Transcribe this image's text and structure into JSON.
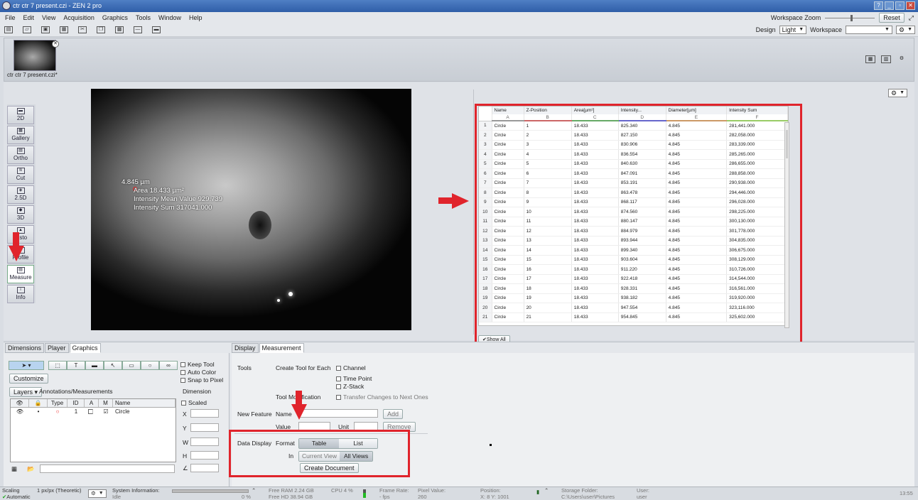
{
  "window": {
    "title": "ctr ctr 7 present.czi - ZEN 2 pro",
    "reset": "Reset"
  },
  "menu": [
    "File",
    "Edit",
    "View",
    "Acquisition",
    "Graphics",
    "Tools",
    "Window",
    "Help"
  ],
  "workspace_zoom": "Workspace Zoom",
  "design": {
    "label": "Design",
    "value": "Light",
    "workspace_label": "Workspace",
    "workspace_value": ""
  },
  "document": {
    "name": "ctr ctr 7 present.czi*"
  },
  "view_buttons": [
    "2D",
    "Gallery",
    "Ortho",
    "Cut",
    "2.5D",
    "3D",
    "Histo",
    "Profile",
    "Measure",
    "Info"
  ],
  "overlay": {
    "diameter": "4.845 µm",
    "area": "Area 18.433 µm²",
    "mean": "Intensity Mean Value 929.739",
    "sum": "Intensity Sum 317041.000"
  },
  "table": {
    "headers": [
      "Name",
      "Z-Position",
      "Area[µm²]",
      "Intensity...",
      "Diameter[µm]",
      "Intensity Sum"
    ],
    "letters": [
      "A",
      "B",
      "C",
      "D",
      "E",
      "F"
    ],
    "rows": [
      [
        "1",
        "Circle",
        "1",
        "18.433",
        "825.340",
        "4.845",
        "281,441.000"
      ],
      [
        "2",
        "Circle",
        "2",
        "18.433",
        "827.150",
        "4.845",
        "282,058.000"
      ],
      [
        "3",
        "Circle",
        "3",
        "18.433",
        "830.906",
        "4.845",
        "283,339.000"
      ],
      [
        "4",
        "Circle",
        "4",
        "18.433",
        "836.554",
        "4.845",
        "285,265.000"
      ],
      [
        "5",
        "Circle",
        "5",
        "18.433",
        "840.630",
        "4.845",
        "286,655.000"
      ],
      [
        "6",
        "Circle",
        "6",
        "18.433",
        "847.091",
        "4.845",
        "288,858.000"
      ],
      [
        "7",
        "Circle",
        "7",
        "18.433",
        "853.191",
        "4.845",
        "290,938.000"
      ],
      [
        "8",
        "Circle",
        "8",
        "18.433",
        "863.478",
        "4.845",
        "294,446.000"
      ],
      [
        "9",
        "Circle",
        "9",
        "18.433",
        "868.117",
        "4.845",
        "296,028.000"
      ],
      [
        "10",
        "Circle",
        "10",
        "18.433",
        "874.560",
        "4.845",
        "298,225.000"
      ],
      [
        "11",
        "Circle",
        "11",
        "18.433",
        "880.147",
        "4.845",
        "300,130.000"
      ],
      [
        "12",
        "Circle",
        "12",
        "18.433",
        "884.979",
        "4.845",
        "301,778.000"
      ],
      [
        "13",
        "Circle",
        "13",
        "18.433",
        "893.944",
        "4.845",
        "304,835.000"
      ],
      [
        "14",
        "Circle",
        "14",
        "18.433",
        "899.340",
        "4.845",
        "306,675.000"
      ],
      [
        "15",
        "Circle",
        "15",
        "18.433",
        "903.604",
        "4.845",
        "308,129.000"
      ],
      [
        "16",
        "Circle",
        "16",
        "18.433",
        "911.220",
        "4.845",
        "310,726.000"
      ],
      [
        "17",
        "Circle",
        "17",
        "18.433",
        "922.418",
        "4.845",
        "314,544.000"
      ],
      [
        "18",
        "Circle",
        "18",
        "18.433",
        "928.331",
        "4.845",
        "316,561.000"
      ],
      [
        "19",
        "Circle",
        "19",
        "18.433",
        "938.182",
        "4.845",
        "319,920.000"
      ],
      [
        "20",
        "Circle",
        "20",
        "18.433",
        "947.554",
        "4.845",
        "323,116.000"
      ],
      [
        "21",
        "Circle",
        "21",
        "18.433",
        "954.845",
        "4.845",
        "325,602.000"
      ]
    ],
    "show_all": "Show All"
  },
  "left_tabs": [
    "Dimensions",
    "Player",
    "Graphics"
  ],
  "graphics": {
    "customize": "Customize",
    "keep_tool": "Keep Tool",
    "auto_color": "Auto Color",
    "snap": "Snap to Pixel",
    "layers": "Layers",
    "annotations": "Annotations/Measurements",
    "dimension": "Dimension",
    "scaled": "Scaled",
    "cols": [
      "Type",
      "ID",
      "A",
      "M",
      "Name"
    ],
    "row": {
      "id": "1",
      "name": "Circle"
    },
    "fields": [
      "X",
      "Y",
      "W",
      "H"
    ]
  },
  "right_tabs": [
    "Display",
    "Measurement"
  ],
  "measurement": {
    "tools": "Tools",
    "create_tool": "Create Tool for Each",
    "channel": "Channel",
    "time_point": "Time Point",
    "z_stack": "Z-Stack",
    "tool_mod": "Tool Modification",
    "transfer": "Transfer Changes to Next Ones",
    "new_feature": "New Feature",
    "name": "Name",
    "add": "Add",
    "value": "Value",
    "unit": "Unit",
    "remove": "Remove",
    "data_display": "Data Display",
    "format": "Format",
    "table": "Table",
    "list": "List",
    "in": "In",
    "current_view": "Current View",
    "all_views": "All Views",
    "create_doc": "Create Document"
  },
  "status": {
    "scaling": "Scaling",
    "scaling_val": "1 px/px (Theoretic)",
    "automatic": "Automatic",
    "sysinfo": "System Information:",
    "idle": "Idle",
    "pct": "0 %",
    "free_ram": "Free RAM  2.24 GB",
    "free_hd": "Free HD   38.94 GB",
    "cpu": "CPU 4 %",
    "frame_rate": "Frame Rate:",
    "fps": "- fps",
    "pixel_value": "Pixel Value:",
    "pv": "260",
    "position": "Position:",
    "pos_val": "X: 8     Y: 1001",
    "storage": "Storage Folder:",
    "storage_val": "C:\\Users\\user\\Pictures",
    "user": "User:",
    "user_val": "user",
    "time": "13:55"
  }
}
